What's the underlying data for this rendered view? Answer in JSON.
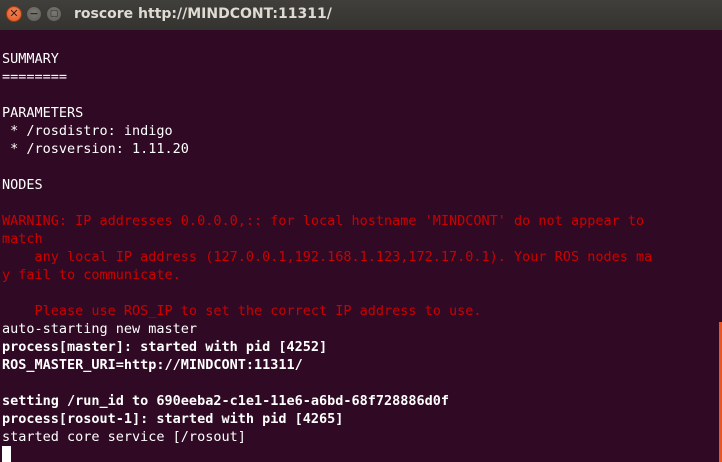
{
  "window": {
    "title": "roscore http://MINDCONT:11311/",
    "close_symbol": "✕",
    "minimize_symbol": "−",
    "maximize_symbol": "▢"
  },
  "colors": {
    "background": "#300a24",
    "text": "#ffffff",
    "warning": "#cc0000",
    "scrollbar": "#e95420"
  },
  "terminal": {
    "lines": [
      {
        "text": "SUMMARY",
        "style": "normal"
      },
      {
        "text": "========",
        "style": "normal"
      },
      {
        "text": "",
        "style": "normal"
      },
      {
        "text": "PARAMETERS",
        "style": "normal"
      },
      {
        "text": " * /rosdistro: indigo",
        "style": "normal"
      },
      {
        "text": " * /rosversion: 1.11.20",
        "style": "normal"
      },
      {
        "text": "",
        "style": "normal"
      },
      {
        "text": "NODES",
        "style": "normal"
      },
      {
        "text": "",
        "style": "normal"
      },
      {
        "text": "WARNING: IP addresses 0.0.0.0,:: for local hostname 'MINDCONT' do not appear to",
        "style": "red"
      },
      {
        "text": "match",
        "style": "red"
      },
      {
        "text": "    any local IP address (127.0.0.1,192.168.1.123,172.17.0.1). Your ROS nodes ma",
        "style": "red"
      },
      {
        "text": "y fail to communicate.",
        "style": "red"
      },
      {
        "text": "",
        "style": "red"
      },
      {
        "text": "    Please use ROS_IP to set the correct IP address to use.",
        "style": "red"
      },
      {
        "text": "auto-starting new master",
        "style": "normal"
      },
      {
        "text": "process[master]: started with pid [4252]",
        "style": "bold"
      },
      {
        "text": "ROS_MASTER_URI=http://MINDCONT:11311/",
        "style": "bold"
      },
      {
        "text": "",
        "style": "normal"
      },
      {
        "text": "setting /run_id to 690eeba2-c1e1-11e6-a6bd-68f728886d0f",
        "style": "bold"
      },
      {
        "text": "process[rosout-1]: started with pid [4265]",
        "style": "bold"
      },
      {
        "text": "started core service [/rosout]",
        "style": "normal"
      }
    ]
  }
}
